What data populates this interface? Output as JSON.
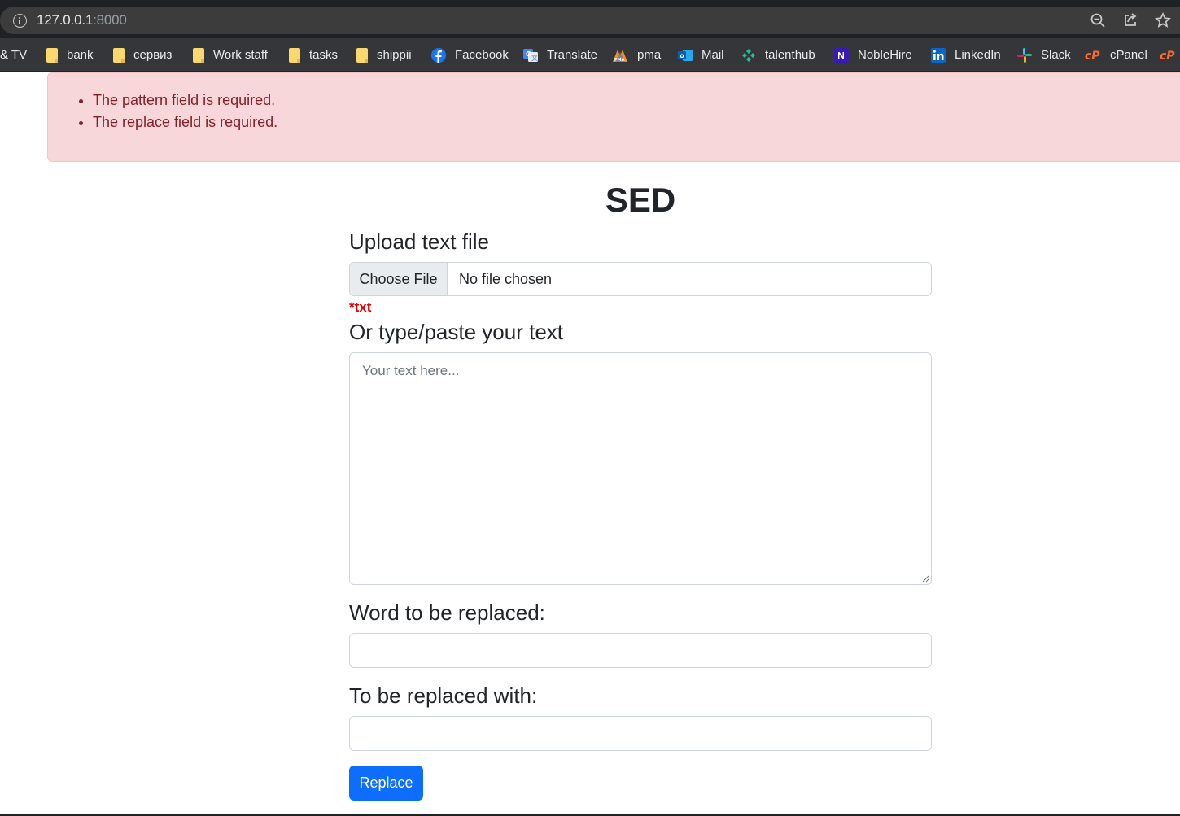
{
  "browser": {
    "url_host": "127.0.0.1",
    "url_port": ":8000",
    "icons": [
      "info-icon",
      "zoom-icon",
      "share-icon",
      "star-icon"
    ]
  },
  "bookmarks": [
    {
      "label": "& TV",
      "icon": "none"
    },
    {
      "label": "bank",
      "icon": "folder-icon"
    },
    {
      "label": "сервиз",
      "icon": "folder-icon"
    },
    {
      "label": "Work staff",
      "icon": "folder-icon"
    },
    {
      "label": "tasks",
      "icon": "folder-icon"
    },
    {
      "label": "shippii",
      "icon": "folder-icon"
    },
    {
      "label": "Facebook",
      "icon": "facebook-icon"
    },
    {
      "label": "Translate",
      "icon": "translate-icon"
    },
    {
      "label": "pma",
      "icon": "phpmyadmin-icon"
    },
    {
      "label": "Mail",
      "icon": "outlook-icon"
    },
    {
      "label": "talenthub",
      "icon": "talenthub-icon"
    },
    {
      "label": "NobleHire",
      "icon": "noblehire-icon"
    },
    {
      "label": "LinkedIn",
      "icon": "linkedin-icon"
    },
    {
      "label": "Slack",
      "icon": "slack-icon"
    },
    {
      "label": "cPanel",
      "icon": "cpanel-icon"
    }
  ],
  "alert": {
    "errors": [
      "The pattern field is required.",
      "The replace field is required."
    ]
  },
  "page": {
    "title": "SED",
    "upload_label": "Upload text file",
    "choose_file": "Choose File",
    "no_file": "No file chosen",
    "file_hint": "*txt",
    "text_label": "Or type/paste your text",
    "text_placeholder": "Your text here...",
    "pattern_label": "Word to be replaced:",
    "pattern_value": "",
    "replace_label": "To be replaced with:",
    "replace_value": "",
    "submit_label": "Replace"
  },
  "colors": {
    "alert_bg": "#f8d7da",
    "alert_text": "#842029",
    "button_bg": "#0d6efd",
    "hint_text": "#dc0000"
  }
}
